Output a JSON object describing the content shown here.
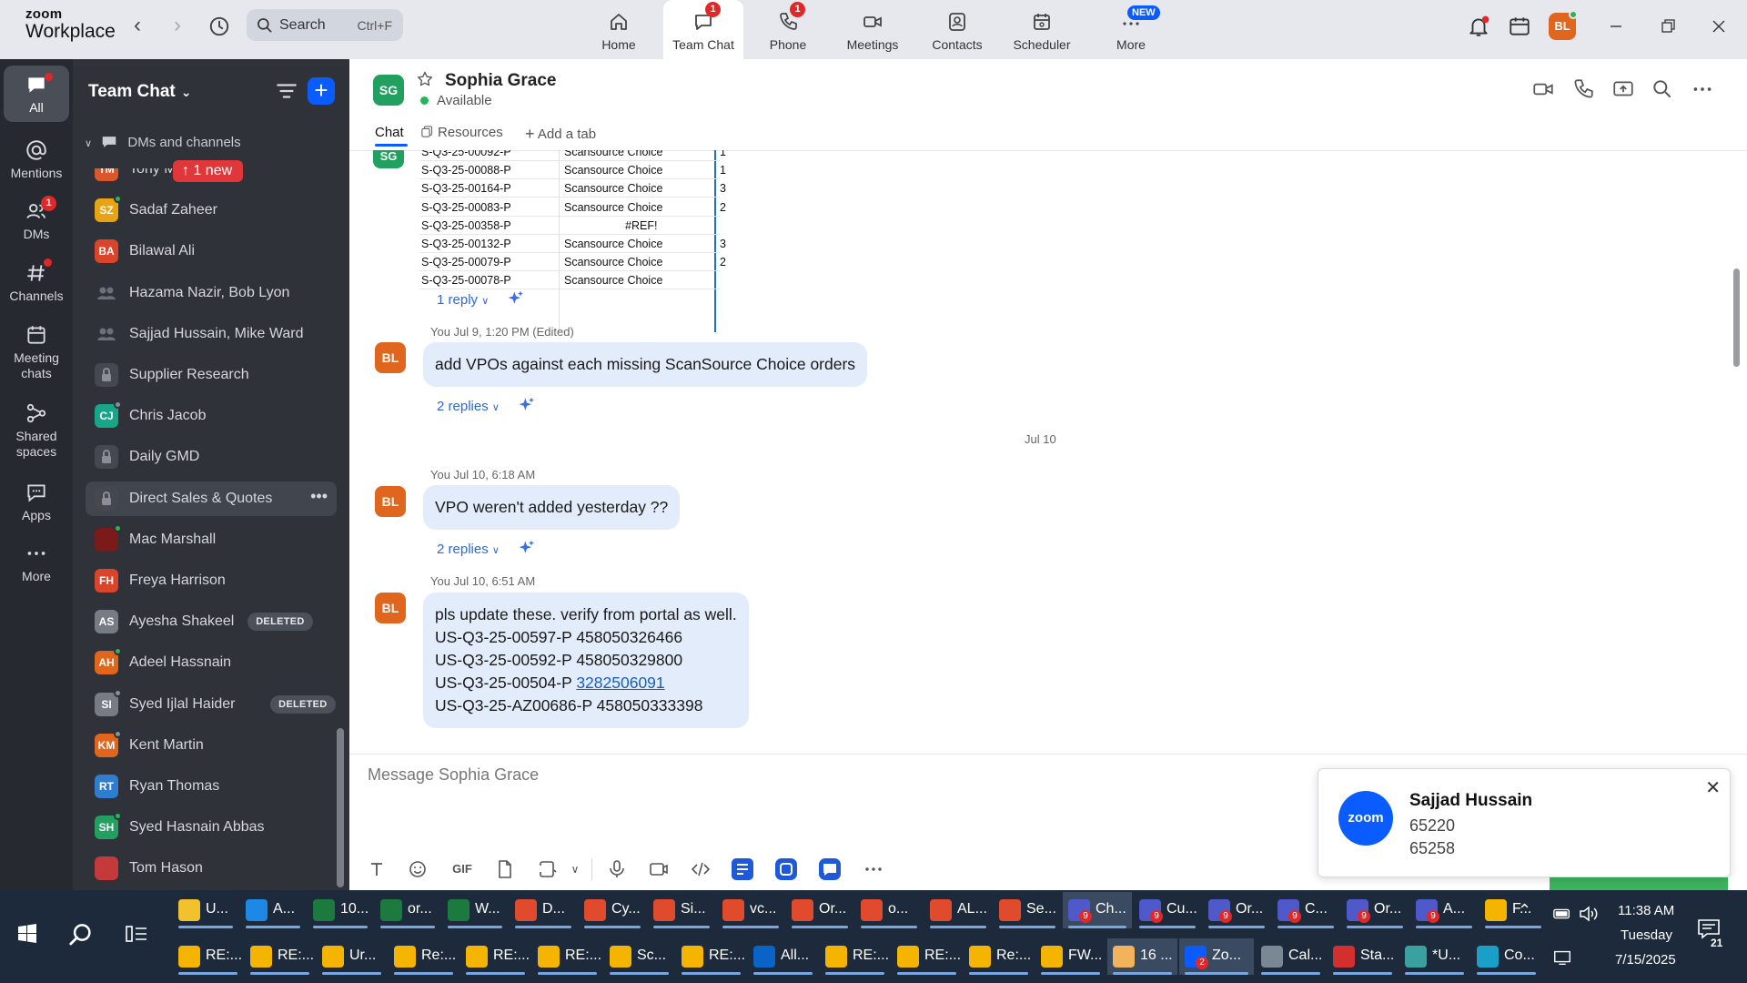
{
  "app": {
    "logo_line1": "zoom",
    "logo_line2": "Workplace",
    "search_placeholder": "Search",
    "search_shortcut": "Ctrl+F"
  },
  "topnav": [
    {
      "label": "Home",
      "icon": "home-icon"
    },
    {
      "label": "Team Chat",
      "icon": "chat-icon",
      "badge": "1",
      "active": true
    },
    {
      "label": "Phone",
      "icon": "phone-icon",
      "badge": "1"
    },
    {
      "label": "Meetings",
      "icon": "video-icon"
    },
    {
      "label": "Contacts",
      "icon": "contacts-icon"
    },
    {
      "label": "Scheduler",
      "icon": "calendar-icon"
    },
    {
      "label": "More",
      "icon": "more-icon",
      "tag": "NEW"
    }
  ],
  "profile_initials": "BL",
  "rail": [
    {
      "label": "All",
      "icon": "chat-bubble-icon",
      "active": true
    },
    {
      "label": "Mentions",
      "icon": "at-icon"
    },
    {
      "label": "DMs",
      "icon": "people-icon",
      "badge": "1"
    },
    {
      "label": "Channels",
      "icon": "hash-icon"
    },
    {
      "label": "Meeting chats",
      "icon": "meeting-calendar-icon"
    },
    {
      "label": "Shared spaces",
      "icon": "shared-spaces-icon"
    },
    {
      "label": "Apps",
      "icon": "apps-icon"
    },
    {
      "label": "More",
      "icon": "ellipsis-icon"
    }
  ],
  "sidebar": {
    "title": "Team Chat",
    "section": "DMs and channels",
    "new_pill": "1 new",
    "items": [
      {
        "name": "Tony M",
        "initials": "TM",
        "color": "#d9572b",
        "presence": "#2bb35a"
      },
      {
        "name": "Sadaf Zaheer",
        "initials": "SZ",
        "color": "#e8a315",
        "presence": "#2bb35a"
      },
      {
        "name": "Bilawal Ali",
        "initials": "BA",
        "color": "#d9442b",
        "presence": ""
      },
      {
        "name": "Hazama Nazir, Bob Lyon",
        "type": "group"
      },
      {
        "name": "Sajjad Hussain, Mike Ward",
        "type": "group"
      },
      {
        "name": "Supplier Research",
        "type": "private"
      },
      {
        "name": "Chris Jacob",
        "initials": "CJ",
        "color": "#18a58a",
        "presence": "#8a8e96"
      },
      {
        "name": "Daily GMD",
        "type": "private"
      },
      {
        "name": "Direct Sales & Quotes",
        "type": "private",
        "selected": true
      },
      {
        "name": "Mac Marshall",
        "initials": "",
        "color": "#7a1a1a",
        "presence": "#2bb35a"
      },
      {
        "name": "Freya Harrison",
        "initials": "FH",
        "color": "#d9442b",
        "presence": ""
      },
      {
        "name": "Ayesha Shakeel",
        "initials": "AS",
        "color": "#767b84",
        "presence": "",
        "tag": "DELETED"
      },
      {
        "name": "Adeel Hassnain",
        "initials": "AH",
        "color": "#e0651d",
        "presence": "#2bb35a"
      },
      {
        "name": "Syed Ijlal Haider",
        "initials": "SI",
        "color": "#767b84",
        "presence": "#8a8e96",
        "tag": "DELETED"
      },
      {
        "name": "Kent Martin",
        "initials": "KM",
        "color": "#e0651d",
        "presence": "#8a8e96"
      },
      {
        "name": "Ryan Thomas",
        "initials": "RT",
        "color": "#2e7dd1",
        "presence": ""
      },
      {
        "name": "Syed Hasnain Abbas",
        "initials": "SH",
        "color": "#22a060",
        "presence": "#2bb35a"
      },
      {
        "name": "Tom Hason",
        "initials": "",
        "color": "#c43a3a",
        "presence": ""
      }
    ]
  },
  "chat_header": {
    "initials": "SG",
    "name": "Sophia Grace",
    "status": "Available",
    "tabs": [
      "Chat",
      "Resources",
      "Add a tab"
    ]
  },
  "sheet_rows": [
    {
      "id": "S-Q3-25-00092-P",
      "supplier": "Scansource Choice",
      "extra": "",
      "qty": "1"
    },
    {
      "id": "S-Q3-25-00088-P",
      "supplier": "Scansource Choice",
      "extra": "",
      "qty": "1"
    },
    {
      "id": "S-Q3-25-00164-P",
      "supplier": "Scansource Choice",
      "extra": "",
      "qty": "3"
    },
    {
      "id": "S-Q3-25-00083-P",
      "supplier": "Scansource Choice",
      "extra": "",
      "qty": "2"
    },
    {
      "id": "S-Q3-25-00358-P",
      "supplier": "",
      "extra": "#REF!",
      "qty": ""
    },
    {
      "id": "S-Q3-25-00132-P",
      "supplier": "Scansource Choice",
      "extra": "",
      "qty": "3"
    },
    {
      "id": "S-Q3-25-00079-P",
      "supplier": "Scansource Choice",
      "extra": "",
      "qty": "2"
    },
    {
      "id": "S-Q3-25-00078-P",
      "supplier": "Scansource Choice",
      "extra": "",
      "qty": ""
    }
  ],
  "messages": {
    "reply1": "1 reply",
    "m1_meta": "You Jul 9, 1:20 PM (Edited)",
    "m1_text": "add VPOs against each missing ScanSource Choice orders",
    "m1_replies": "2 replies",
    "date_sep": "Jul 10",
    "m2_meta": "You Jul 10, 6:18 AM",
    "m2_text": "VPO weren't added yesterday ??",
    "m2_replies": "2 replies",
    "m3_meta": "You Jul 10, 6:51 AM",
    "m3_line1": "pls update these. verify from portal as well.",
    "m3_line2": "US-Q3-25-00597-P 458050326466",
    "m3_line3": "US-Q3-25-00592-P 458050329800",
    "m3_line4a": "US-Q3-25-00504-P ",
    "m3_line4_link": "3282506091",
    "m3_line5": "US-Q3-25-AZ00686-P 458050333398"
  },
  "composer": {
    "placeholder": "Message Sophia Grace",
    "gif": "GIF"
  },
  "toast": {
    "logo": "zoom",
    "name": "Sajjad Hussain",
    "line1": "65220",
    "line2": "65258"
  },
  "taskbar_row1": [
    {
      "label": "U...",
      "color": "#f2c12e"
    },
    {
      "label": "A...",
      "color": "#1e88e5"
    },
    {
      "label": "10...",
      "color": "#1d7a3e"
    },
    {
      "label": "or...",
      "color": "#1d7a3e"
    },
    {
      "label": "W...",
      "color": "#1d7a3e"
    },
    {
      "label": "D...",
      "color": "#e04a2d"
    },
    {
      "label": "Cy...",
      "color": "#e04a2d"
    },
    {
      "label": "Si...",
      "color": "#e04a2d"
    },
    {
      "label": "vc...",
      "color": "#e04a2d"
    },
    {
      "label": "Or...",
      "color": "#e04a2d"
    },
    {
      "label": "o...",
      "color": "#e04a2d"
    },
    {
      "label": "AL...",
      "color": "#e04a2d"
    },
    {
      "label": "Se...",
      "color": "#e04a2d"
    },
    {
      "label": "Ch...",
      "color": "#5059c9",
      "badge": "9",
      "active": true
    },
    {
      "label": "Cu...",
      "color": "#5059c9",
      "badge": "9"
    },
    {
      "label": "Or...",
      "color": "#5059c9",
      "badge": "9"
    },
    {
      "label": "C...",
      "color": "#5059c9",
      "badge": "9"
    },
    {
      "label": "Or...",
      "color": "#5059c9",
      "badge": "9"
    },
    {
      "label": "A...",
      "color": "#5059c9",
      "badge": "9"
    },
    {
      "label": "F...",
      "color": "#f4b400"
    }
  ],
  "taskbar_row2": [
    {
      "label": "RE:...",
      "color": "#f4b400"
    },
    {
      "label": "RE:...",
      "color": "#f4b400"
    },
    {
      "label": "Ur...",
      "color": "#f4b400"
    },
    {
      "label": "Re:...",
      "color": "#f4b400"
    },
    {
      "label": "RE:...",
      "color": "#f4b400"
    },
    {
      "label": "RE:...",
      "color": "#f4b400"
    },
    {
      "label": "Sc...",
      "color": "#f4b400"
    },
    {
      "label": "RE:...",
      "color": "#f4b400"
    },
    {
      "label": "All...",
      "color": "#0a64c8"
    },
    {
      "label": "RE:...",
      "color": "#f4b400"
    },
    {
      "label": "RE:...",
      "color": "#f4b400"
    },
    {
      "label": "Re:...",
      "color": "#f4b400"
    },
    {
      "label": "FW...",
      "color": "#f4b400"
    },
    {
      "label": "16 ...",
      "color": "#f2b35a",
      "active": true
    },
    {
      "label": "Zo...",
      "color": "#0b5cff",
      "badge": "2",
      "active": true
    },
    {
      "label": "Cal...",
      "color": "#7a8896"
    },
    {
      "label": "Sta...",
      "color": "#d32f2f"
    },
    {
      "label": "*U...",
      "color": "#3aa0a0"
    },
    {
      "label": "Co...",
      "color": "#1aa0c8"
    }
  ],
  "tray": {
    "time": "11:38 AM",
    "day": "Tuesday",
    "date": "7/15/2025",
    "notif_count": "21"
  }
}
